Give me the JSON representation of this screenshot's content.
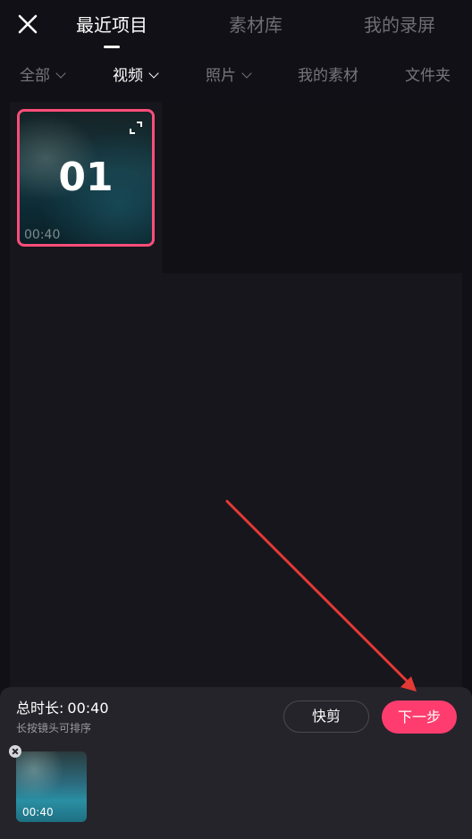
{
  "header": {
    "close_icon": "close-icon",
    "tabs": [
      {
        "label": "最近项目",
        "active": true
      },
      {
        "label": "素材库",
        "active": false
      },
      {
        "label": "我的录屏",
        "active": false
      }
    ]
  },
  "filters": [
    {
      "label": "全部",
      "has_dropdown": true,
      "active": false
    },
    {
      "label": "视频",
      "has_dropdown": true,
      "active": true
    },
    {
      "label": "照片",
      "has_dropdown": true,
      "active": false
    },
    {
      "label": "我的素材",
      "has_dropdown": false,
      "active": false
    },
    {
      "label": "文件夹",
      "has_dropdown": false,
      "active": false
    }
  ],
  "media": [
    {
      "order": "01",
      "duration": "00:40",
      "selected": true,
      "expand_icon": "expand-icon"
    }
  ],
  "bottom_panel": {
    "total_label": "总时长:",
    "total_value": "00:40",
    "hint": "长按镜头可排序",
    "quickcut_label": "快剪",
    "next_label": "下一步",
    "selected_clips": [
      {
        "duration": "00:40",
        "remove_icon": "remove-icon"
      }
    ]
  },
  "colors": {
    "accent": "#fe3d6e",
    "selection_border": "#fe4d79",
    "background": "#111016",
    "panel": "#25242b",
    "annotation_arrow": "#e53935"
  }
}
